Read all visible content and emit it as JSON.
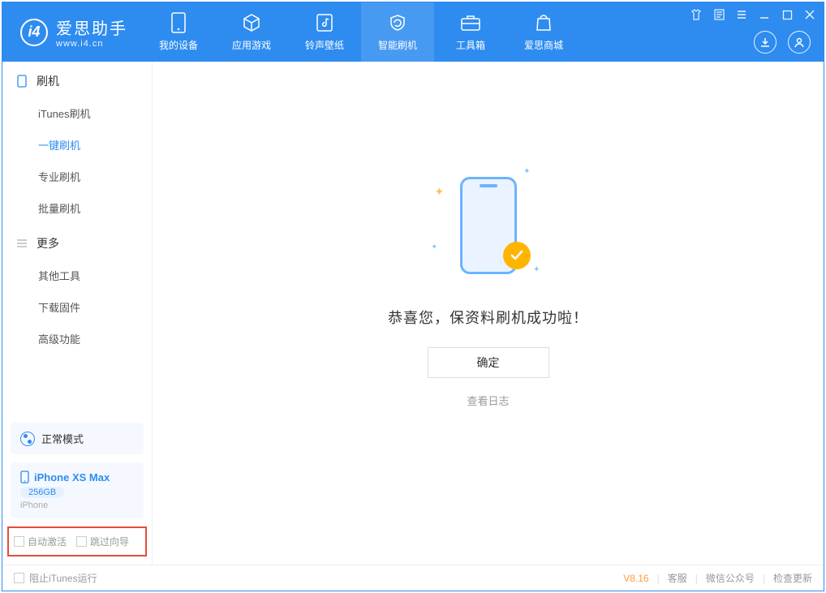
{
  "app": {
    "title": "爱思助手",
    "subtitle": "www.i4.cn"
  },
  "nav": {
    "items": [
      {
        "label": "我的设备"
      },
      {
        "label": "应用游戏"
      },
      {
        "label": "铃声壁纸"
      },
      {
        "label": "智能刷机"
      },
      {
        "label": "工具箱"
      },
      {
        "label": "爱思商城"
      }
    ]
  },
  "sidebar": {
    "group1": {
      "title": "刷机"
    },
    "items1": [
      {
        "label": "iTunes刷机"
      },
      {
        "label": "一键刷机"
      },
      {
        "label": "专业刷机"
      },
      {
        "label": "批量刷机"
      }
    ],
    "group2": {
      "title": "更多"
    },
    "items2": [
      {
        "label": "其他工具"
      },
      {
        "label": "下载固件"
      },
      {
        "label": "高级功能"
      }
    ],
    "mode": {
      "label": "正常模式"
    },
    "device": {
      "name": "iPhone XS Max",
      "storage": "256GB",
      "type": "iPhone"
    },
    "options": {
      "auto_activate": "自动激活",
      "skip_guide": "跳过向导"
    }
  },
  "main": {
    "success_msg": "恭喜您，保资料刷机成功啦！",
    "ok_button": "确定",
    "view_log": "查看日志"
  },
  "footer": {
    "block_itunes": "阻止iTunes运行",
    "version": "V8.16",
    "links": {
      "service": "客服",
      "wechat": "微信公众号",
      "update": "检查更新"
    }
  }
}
